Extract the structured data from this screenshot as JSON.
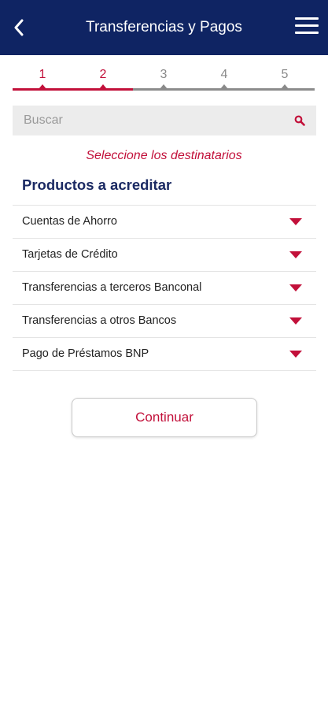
{
  "header": {
    "title": "Transferencias y Pagos",
    "back_icon": "chevron-left-icon",
    "menu_icon": "hamburger-menu-icon",
    "background": "#0f2463"
  },
  "stepper": {
    "steps": [
      "1",
      "2",
      "3",
      "4",
      "5"
    ],
    "current_step": 2,
    "active_color": "#c2103a"
  },
  "search": {
    "placeholder": "Buscar",
    "icon": "search-icon"
  },
  "subtitle": "Seleccione los destinatarios",
  "section_title": "Productos a acreditar",
  "products": [
    {
      "label": "Cuentas de Ahorro"
    },
    {
      "label": "Tarjetas de Crédito"
    },
    {
      "label": "Transferencias a terceros Banconal"
    },
    {
      "label": "Transferencias a otros Bancos"
    },
    {
      "label": "Pago de Préstamos BNP"
    }
  ],
  "continue_label": "Continuar"
}
